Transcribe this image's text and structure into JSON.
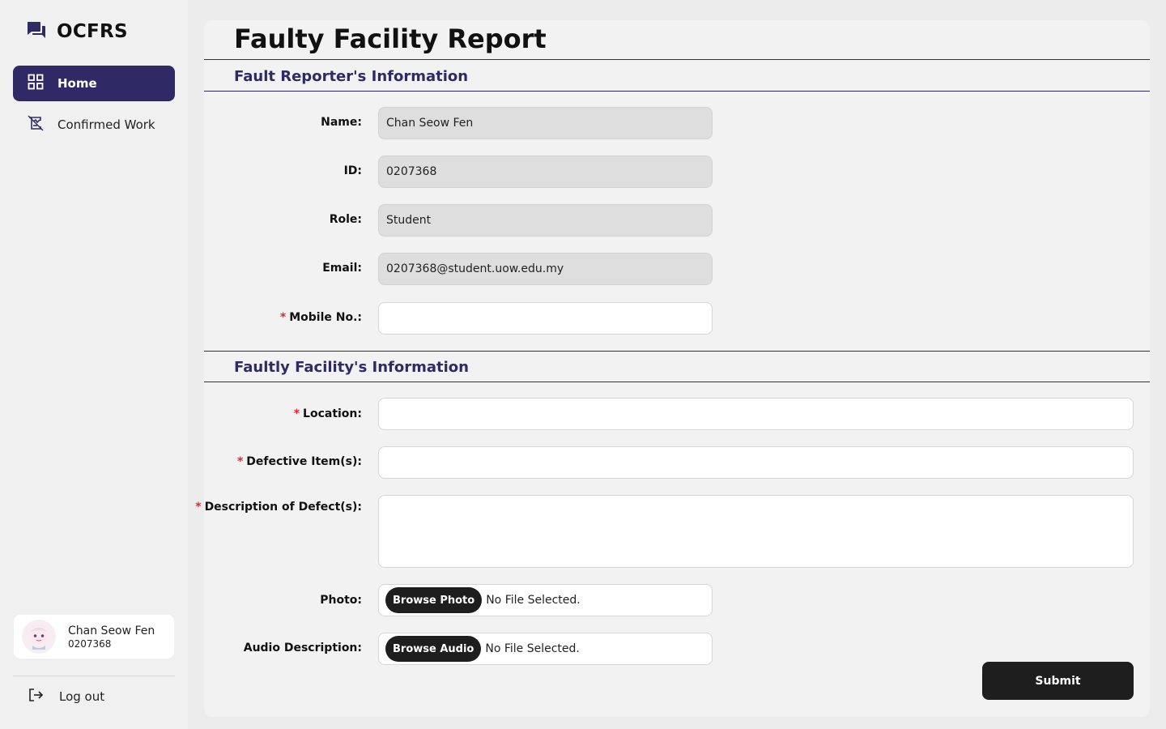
{
  "app": {
    "name": "OCFRS"
  },
  "sidebar": {
    "items": [
      {
        "label": "Home",
        "icon": "grid-icon",
        "active": true
      },
      {
        "label": "Confirmed Work",
        "icon": "signed-document-icon",
        "active": false
      }
    ],
    "user": {
      "name": "Chan Seow Fen",
      "id": "0207368"
    },
    "logout_label": "Log out"
  },
  "page": {
    "title": "Faulty Facility Report"
  },
  "reporter": {
    "section_title": "Fault Reporter's Information",
    "name_label": "Name:",
    "name_value": "Chan Seow Fen",
    "id_label": "ID:",
    "id_value": "0207368",
    "role_label": "Role:",
    "role_value": "Student",
    "email_label": "Email:",
    "email_value": "0207368@student.uow.edu.my",
    "mobile_label": "Mobile No.:",
    "mobile_value": ""
  },
  "facility": {
    "section_title": "Faultly Facility's Information",
    "location_label": "Location:",
    "defective_label": "Defective Item(s):",
    "description_label": "Description of Defect(s):",
    "photo_label": "Photo:",
    "photo_button": "Browse Photo",
    "photo_status": "No File Selected.",
    "audio_label": "Audio Description:",
    "audio_button": "Browse Audio",
    "audio_status": "No File Selected."
  },
  "required_marker": "*",
  "submit_label": "Submit",
  "colors": {
    "accent": "#2f2a66",
    "required": "#e0282e",
    "button": "#1e1e1e"
  }
}
